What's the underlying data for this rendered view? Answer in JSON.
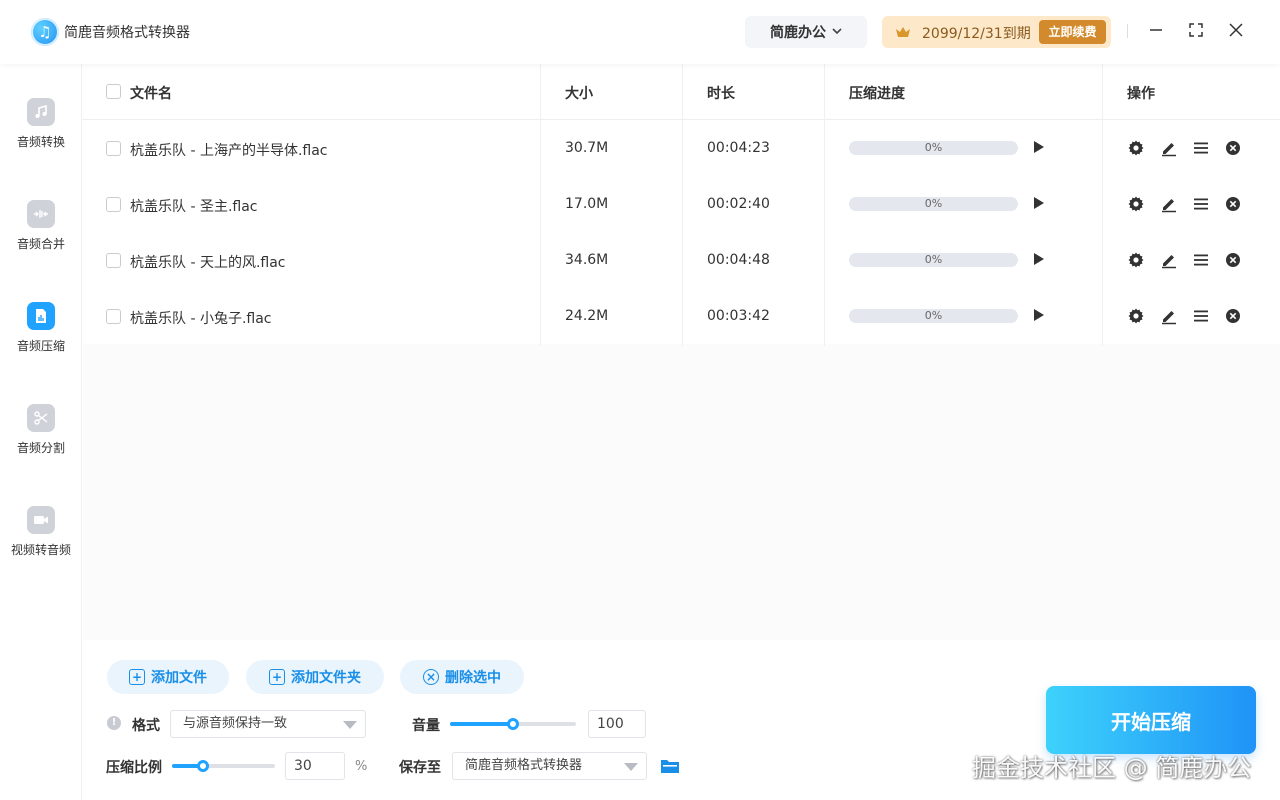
{
  "app": {
    "title": "简鹿音频格式转换器",
    "workspace": "简鹿办公",
    "vip_expiry": "2099/12/31到期",
    "renew_label": "立即续费"
  },
  "sidebar": {
    "items": [
      {
        "label": "音频转换",
        "icon": "music-note-icon",
        "active": false
      },
      {
        "label": "音频合并",
        "icon": "merge-icon",
        "active": false
      },
      {
        "label": "音频压缩",
        "icon": "compress-icon",
        "active": true
      },
      {
        "label": "音频分割",
        "icon": "scissors-icon",
        "active": false
      },
      {
        "label": "视频转音频",
        "icon": "video-camera-icon",
        "active": false
      }
    ]
  },
  "table": {
    "headers": {
      "filename": "文件名",
      "size": "大小",
      "duration": "时长",
      "progress": "压缩进度",
      "actions": "操作"
    },
    "rows": [
      {
        "name": "杭盖乐队 - 上海产的半导体.flac",
        "size": "30.7M",
        "duration": "00:04:23",
        "progress": 0,
        "progress_label": "0%"
      },
      {
        "name": "杭盖乐队 - 圣主.flac",
        "size": "17.0M",
        "duration": "00:02:40",
        "progress": 0,
        "progress_label": "0%"
      },
      {
        "name": "杭盖乐队 - 天上的风.flac",
        "size": "34.6M",
        "duration": "00:04:48",
        "progress": 0,
        "progress_label": "0%"
      },
      {
        "name": "杭盖乐队 - 小兔子.flac",
        "size": "24.2M",
        "duration": "00:03:42",
        "progress": 0,
        "progress_label": "0%"
      }
    ]
  },
  "controls": {
    "add_file": "添加文件",
    "add_folder": "添加文件夹",
    "delete_selected": "删除选中",
    "format_label": "格式",
    "format_value": "与源音频保持一致",
    "volume_label": "音量",
    "volume_value": "100",
    "volume_level": 0.5,
    "ratio_label": "压缩比例",
    "ratio_value": "30",
    "ratio_level": 0.3,
    "ratio_unit": "%",
    "save_label": "保存至",
    "save_value": "简鹿音频格式转换器",
    "start_label": "开始压缩"
  },
  "watermark": "掘金技术社区 @ 简鹿办公",
  "colors": {
    "accent": "#1fa3ff",
    "vip_bg": "#fde9c9",
    "renew_bg": "#d38a2c"
  }
}
